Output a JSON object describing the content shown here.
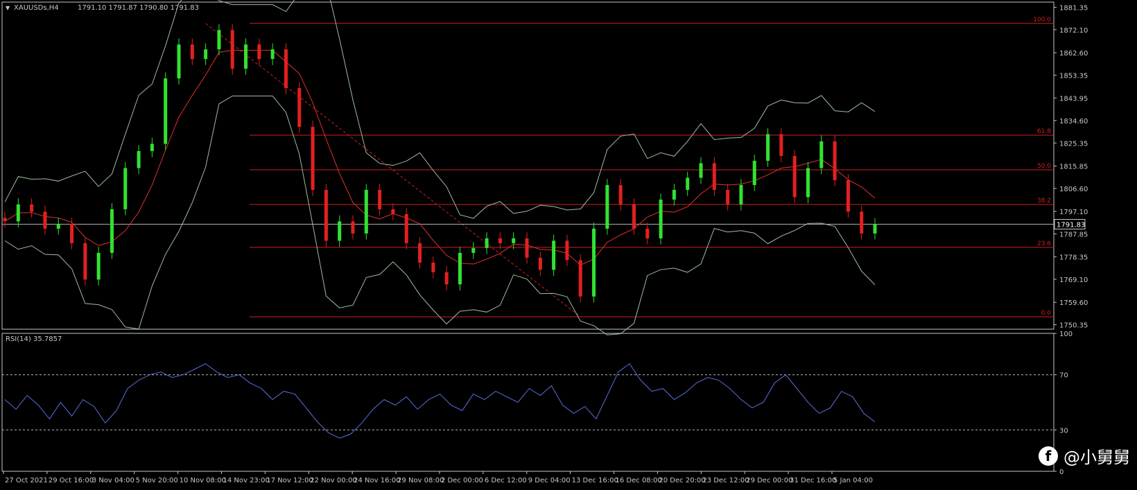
{
  "window": {
    "symbol_title": "XAUUSDs,H4",
    "ohlc": "1791.10 1791.87 1790.80 1791.83",
    "current_price_label": "1791.83"
  },
  "colors": {
    "background": "#000000",
    "axis": "#c8c8c8",
    "bull_candle": "#31e231",
    "bear_candle": "#e32020",
    "bollinger": "#9fbf9f",
    "moving_average": "#e33030",
    "fibonacci": "#cf2020",
    "trendline": "#cf2020",
    "rsi_line": "#5a6fe0",
    "rsi_levels": "#bdbdbd"
  },
  "chart_data": [
    {
      "type": "line",
      "title": "XAUUSDs,H4",
      "subtitle": "1791.10 1791.87 1790.80 1791.83",
      "series_kind": "candlestick",
      "y_ticks": [
        "1881.35",
        "1872.10",
        "1862.60",
        "1853.35",
        "1843.95",
        "1834.60",
        "1825.35",
        "1815.85",
        "1806.60",
        "1797.10",
        "1787.85",
        "1778.35",
        "1769.10",
        "1759.60",
        "1750.35"
      ],
      "y_tick_values": [
        1881.35,
        1872.1,
        1862.6,
        1853.35,
        1843.95,
        1834.6,
        1825.35,
        1815.85,
        1806.6,
        1797.1,
        1787.85,
        1778.35,
        1769.1,
        1759.6,
        1750.35
      ],
      "ylim": [
        1748.5,
        1883.5
      ],
      "x_ticks": [
        "27 Oct 2021",
        "29 Oct 16:00",
        "3 Nov 04:00",
        "5 Nov 20:00",
        "10 Nov 08:00",
        "14 Nov 23:00",
        "17 Nov 12:00",
        "22 Nov 00:00",
        "24 Nov 16:00",
        "29 Nov 08:00",
        "2 Dec 00:00",
        "6 Dec 12:00",
        "9 Dec 04:00",
        "13 Dec 16:00",
        "16 Dec 08:00",
        "20 Dec 20:00",
        "23 Dec 12:00",
        "29 Dec 00:00",
        "31 Dec 16:00",
        "5 Jan 04:00"
      ],
      "current_price": 1791.83,
      "fibonacci_levels": [
        {
          "label": "100.0",
          "value": 1874.7
        },
        {
          "label": "61.8",
          "value": 1828.6
        },
        {
          "label": "50.0",
          "value": 1814.3
        },
        {
          "label": "38.2",
          "value": 1800.0
        },
        {
          "label": "23.6",
          "value": 1782.3
        },
        {
          "label": "0.0",
          "value": 1753.6
        }
      ],
      "trendline": {
        "from": [
          1874.7,
          "14 Nov 23:00"
        ],
        "to": [
          1753.6,
          "13 Dec 16:00"
        ]
      },
      "indicators": [
        "Bollinger Bands",
        "Moving Average"
      ],
      "price_path": [
        {
          "x": "27 Oct 2021",
          "close": 1793
        },
        {
          "x": "27 Oct 2021",
          "close": 1800
        },
        {
          "x": "29 Oct 16:00",
          "close": 1797
        },
        {
          "x": "29 Oct 16:00",
          "close": 1790
        },
        {
          "x": "29 Oct 16:00",
          "close": 1792
        },
        {
          "x": "3 Nov 04:00",
          "close": 1784
        },
        {
          "x": "3 Nov 04:00",
          "close": 1769
        },
        {
          "x": "3 Nov 04:00",
          "close": 1780
        },
        {
          "x": "5 Nov 20:00",
          "close": 1798
        },
        {
          "x": "5 Nov 20:00",
          "close": 1815
        },
        {
          "x": "5 Nov 20:00",
          "close": 1822
        },
        {
          "x": "10 Nov 08:00",
          "close": 1825
        },
        {
          "x": "10 Nov 08:00",
          "close": 1852
        },
        {
          "x": "10 Nov 08:00",
          "close": 1866
        },
        {
          "x": "10 Nov 08:00",
          "close": 1860
        },
        {
          "x": "14 Nov 23:00",
          "close": 1864
        },
        {
          "x": "14 Nov 23:00",
          "close": 1872
        },
        {
          "x": "14 Nov 23:00",
          "close": 1856
        },
        {
          "x": "17 Nov 12:00",
          "close": 1866
        },
        {
          "x": "17 Nov 12:00",
          "close": 1860
        },
        {
          "x": "17 Nov 12:00",
          "close": 1864
        },
        {
          "x": "17 Nov 12:00",
          "close": 1848
        },
        {
          "x": "22 Nov 00:00",
          "close": 1832
        },
        {
          "x": "22 Nov 00:00",
          "close": 1806
        },
        {
          "x": "22 Nov 00:00",
          "close": 1785
        },
        {
          "x": "24 Nov 16:00",
          "close": 1793
        },
        {
          "x": "24 Nov 16:00",
          "close": 1788
        },
        {
          "x": "24 Nov 16:00",
          "close": 1806
        },
        {
          "x": "24 Nov 16:00",
          "close": 1798
        },
        {
          "x": "29 Nov 08:00",
          "close": 1796
        },
        {
          "x": "29 Nov 08:00",
          "close": 1784
        },
        {
          "x": "29 Nov 08:00",
          "close": 1776
        },
        {
          "x": "2 Dec 00:00",
          "close": 1772
        },
        {
          "x": "2 Dec 00:00",
          "close": 1767
        },
        {
          "x": "2 Dec 00:00",
          "close": 1780
        },
        {
          "x": "6 Dec 12:00",
          "close": 1782
        },
        {
          "x": "6 Dec 12:00",
          "close": 1786
        },
        {
          "x": "6 Dec 12:00",
          "close": 1784
        },
        {
          "x": "9 Dec 04:00",
          "close": 1786
        },
        {
          "x": "9 Dec 04:00",
          "close": 1778
        },
        {
          "x": "9 Dec 04:00",
          "close": 1773
        },
        {
          "x": "13 Dec 16:00",
          "close": 1785
        },
        {
          "x": "13 Dec 16:00",
          "close": 1777
        },
        {
          "x": "13 Dec 16:00",
          "close": 1762
        },
        {
          "x": "16 Dec 08:00",
          "close": 1790
        },
        {
          "x": "16 Dec 08:00",
          "close": 1808
        },
        {
          "x": "16 Dec 08:00",
          "close": 1800
        },
        {
          "x": "20 Dec 20:00",
          "close": 1790
        },
        {
          "x": "20 Dec 20:00",
          "close": 1786
        },
        {
          "x": "20 Dec 20:00",
          "close": 1802
        },
        {
          "x": "23 Dec 12:00",
          "close": 1806
        },
        {
          "x": "23 Dec 12:00",
          "close": 1811
        },
        {
          "x": "23 Dec 12:00",
          "close": 1817
        },
        {
          "x": "29 Dec 00:00",
          "close": 1806
        },
        {
          "x": "29 Dec 00:00",
          "close": 1800
        },
        {
          "x": "29 Dec 00:00",
          "close": 1808
        },
        {
          "x": "31 Dec 16:00",
          "close": 1818
        },
        {
          "x": "31 Dec 16:00",
          "close": 1829
        },
        {
          "x": "31 Dec 16:00",
          "close": 1820
        },
        {
          "x": "31 Dec 16:00",
          "close": 1803
        },
        {
          "x": "5 Jan 04:00",
          "close": 1815
        },
        {
          "x": "5 Jan 04:00",
          "close": 1826
        },
        {
          "x": "5 Jan 04:00",
          "close": 1810
        },
        {
          "x": "5 Jan 04:00",
          "close": 1797
        },
        {
          "x": "5 Jan 04:00",
          "close": 1788
        },
        {
          "x": "5 Jan 04:00",
          "close": 1791.83
        }
      ]
    },
    {
      "type": "line",
      "title": "RSI(14) 35.7857",
      "y_ticks": [
        "100",
        "70",
        "30",
        "0"
      ],
      "y_tick_values": [
        100,
        70,
        30,
        0
      ],
      "ylim": [
        0,
        100
      ],
      "levels": [
        70,
        30
      ],
      "current_value": 35.7857,
      "values": [
        52,
        45,
        55,
        48,
        38,
        50,
        40,
        52,
        47,
        35,
        44,
        60,
        66,
        70,
        72,
        68,
        70,
        74,
        78,
        72,
        68,
        70,
        64,
        60,
        52,
        58,
        56,
        46,
        36,
        28,
        24,
        27,
        35,
        45,
        52,
        48,
        54,
        45,
        52,
        56,
        48,
        44,
        56,
        52,
        58,
        54,
        50,
        60,
        55,
        62,
        48,
        42,
        47,
        38,
        55,
        72,
        78,
        66,
        58,
        60,
        52,
        57,
        64,
        68,
        66,
        60,
        52,
        46,
        50,
        64,
        70,
        60,
        50,
        42,
        46,
        58,
        54,
        42,
        35.7857
      ]
    }
  ],
  "watermark": {
    "icon": "facebook-icon",
    "text": "@小舅舅"
  }
}
